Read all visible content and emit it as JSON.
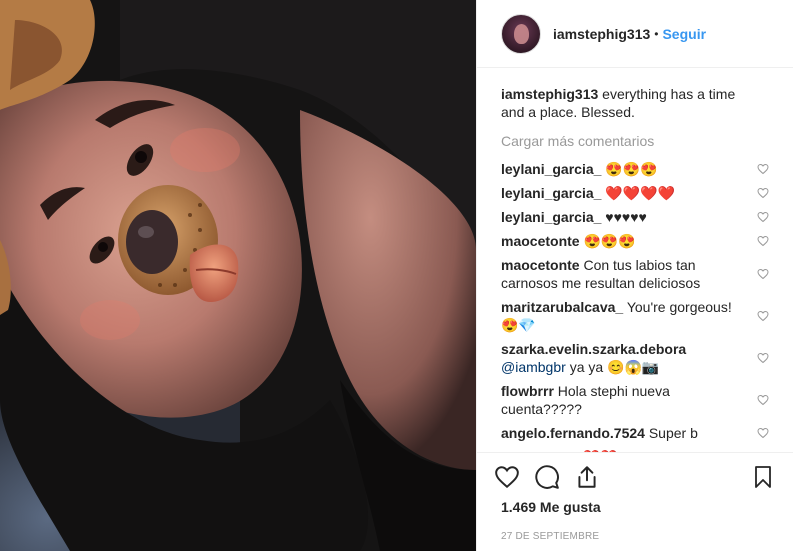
{
  "post": {
    "username": "iamstephig313",
    "follow_label": "Seguir",
    "separator": "•",
    "caption": "everything has a time and a place. Blessed.",
    "load_more": "Cargar más comentarios",
    "likes": "1.469 Me gusta",
    "date": "27 DE SEPTIEMBRE"
  },
  "comments": [
    {
      "user": "leylani_garcia_",
      "text": "😍😍😍"
    },
    {
      "user": "leylani_garcia_",
      "text": "❤️❤️❤️❤️"
    },
    {
      "user": "leylani_garcia_",
      "text": "♥♥♥♥♥"
    },
    {
      "user": "maocetonte",
      "text": "😍😍😍"
    },
    {
      "user": "maocetonte",
      "text": "Con tus labios tan carnosos me resultan deliciosos"
    },
    {
      "user": "maritzarubalcava_",
      "text": "You're gorgeous!😍💎"
    },
    {
      "user": "szarka.evelin.szarka.debora",
      "mention": "@iambgbr",
      "text": "ya ya 😊😱📷"
    },
    {
      "user": "flowbrrr",
      "text": "Hola stephi nueva cuenta?????"
    },
    {
      "user": "angelo.fernando.7524",
      "text": "Super b"
    },
    {
      "user": "tifanyoficial",
      "text": "❤️❤️"
    }
  ],
  "icons": {
    "like": "heart-icon",
    "comment": "comment-icon",
    "share": "share-icon",
    "save": "bookmark-icon"
  },
  "colors": {
    "link": "#3897f0",
    "muted": "#999999",
    "text": "#262626",
    "border": "#efefef"
  }
}
